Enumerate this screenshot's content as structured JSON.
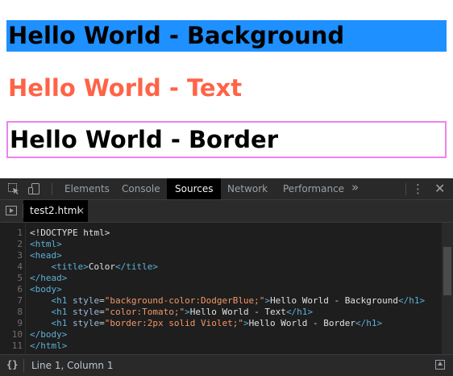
{
  "page": {
    "h1_background": "Hello World - Background",
    "h1_text": "Hello World - Text",
    "h1_border": "Hello World - Border"
  },
  "colors": {
    "dodgerblue": "#1e90ff",
    "tomato": "#ff6347",
    "violet": "#ee82ee",
    "devtools_bg": "#242424"
  },
  "devtools": {
    "icons": [
      "inspect-element-icon",
      "device-toolbar-icon"
    ],
    "tabs": [
      "Elements",
      "Console",
      "Sources",
      "Network",
      "Performance"
    ],
    "active_tab": "Sources",
    "more_tabs": "»",
    "menu": "⋮",
    "close": "✕",
    "file_tab": "test2.html",
    "file_close": "×",
    "code_lines": [
      {
        "n": "1",
        "text": "<!DOCTYPE html>"
      },
      {
        "n": "2",
        "text": "<html>"
      },
      {
        "n": "3",
        "text": "<head>"
      },
      {
        "n": "4",
        "text": "    <title>Color</title>"
      },
      {
        "n": "5",
        "text": "</head>"
      },
      {
        "n": "6",
        "text": "<body>"
      },
      {
        "n": "7",
        "text": "    <h1 style=\"background-color:DodgerBlue;\">Hello World - Background</h1>"
      },
      {
        "n": "8",
        "text": "    <h1 style=\"color:Tomato;\">Hello World - Text</h1>"
      },
      {
        "n": "9",
        "text": "    <h1 style=\"border:2px solid Violet;\">Hello World - Border</h1>"
      },
      {
        "n": "10",
        "text": "</body>"
      },
      {
        "n": "11",
        "text": "</html>"
      }
    ],
    "status": {
      "braces": "{}",
      "cursor": "Line 1, Column 1"
    }
  }
}
